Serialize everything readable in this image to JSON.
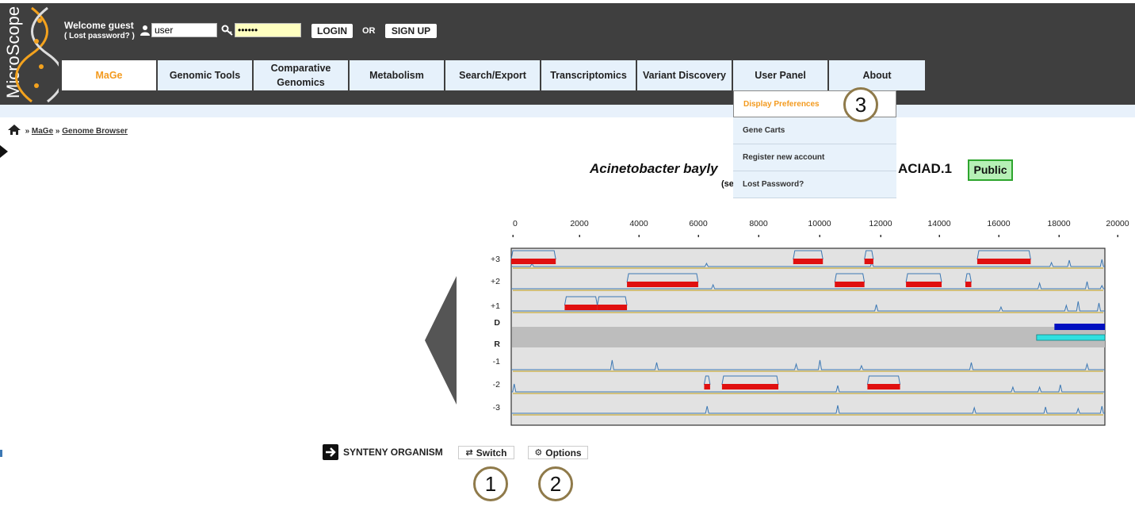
{
  "app": {
    "logo_text": "MicroScope"
  },
  "header": {
    "welcome": "Welcome guest",
    "lost_password": "( Lost password? )",
    "username_value": "user",
    "password_value": "••••••",
    "login_label": "LOGIN",
    "or_label": "OR",
    "signup_label": "SIGN UP"
  },
  "nav": {
    "items": [
      {
        "label": "MaGe"
      },
      {
        "label": "Genomic Tools"
      },
      {
        "label": "Comparative Genomics"
      },
      {
        "label": "Metabolism"
      },
      {
        "label": "Search/Export"
      },
      {
        "label": "Transcriptomics"
      },
      {
        "label": "Variant Discovery"
      },
      {
        "label": "User Panel"
      },
      {
        "label": "About"
      }
    ]
  },
  "user_menu": {
    "items": [
      {
        "label": "Display Preferences"
      },
      {
        "label": "Gene Carts"
      },
      {
        "label": "Register new account"
      },
      {
        "label": "Lost Password?"
      }
    ]
  },
  "breadcrumb": {
    "sep": "»",
    "items": [
      "MaGe",
      "Genome Browser"
    ]
  },
  "genome": {
    "organism_visible": "Acinetobacter bayly",
    "sub_visible": "(se",
    "strain_visible": "ACIAD.1",
    "badge": "Public"
  },
  "browser": {
    "ticks": [
      "0",
      "2000",
      "4000",
      "6000",
      "8000",
      "10000",
      "12000",
      "14000",
      "16000",
      "18000",
      "20000"
    ],
    "frame_labels": [
      "+3",
      "+2",
      "+1",
      "D",
      "R",
      "-1",
      "-2",
      "-3"
    ],
    "colors": {
      "cds": "#e01010",
      "direct": "#0010c0",
      "reverse": "#30e0e0",
      "curve": "#3c78b4",
      "track_bg": "#e2e2e2"
    }
  },
  "controls": {
    "synteny_label": "SYNTENY ORGANISM",
    "switch_label": "Switch",
    "options_label": "Options"
  },
  "callouts": [
    "1",
    "2",
    "3"
  ]
}
